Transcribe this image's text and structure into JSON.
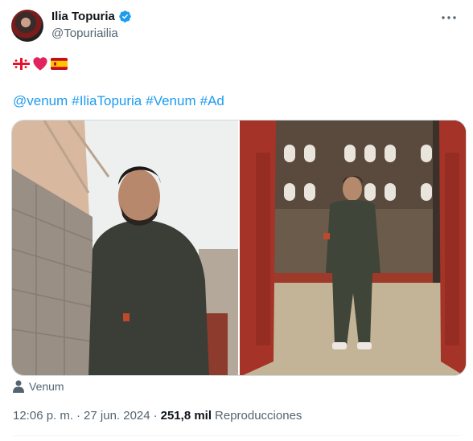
{
  "author": {
    "name": "Ilia Topuria",
    "handle": "@Topuriailia",
    "verified": true
  },
  "tweet": {
    "emoji_line": [
      "georgia-flag",
      "red-heart",
      "spain-flag"
    ],
    "hashtags": [
      "@venum",
      "#IliaTopuria",
      "#Venum",
      "#Ad"
    ]
  },
  "media": {
    "photo_count": 2
  },
  "location": {
    "label": "Venum",
    "icon": "person-icon"
  },
  "meta": {
    "time": "12:06 p. m.",
    "separator": "·",
    "date": "27 jun. 2024",
    "views_count": "251,8 mil",
    "views_label": "Reproducciones"
  },
  "colors": {
    "link": "#1d9bf0",
    "secondary_text": "#536471",
    "verified": "#1d9bf0"
  }
}
